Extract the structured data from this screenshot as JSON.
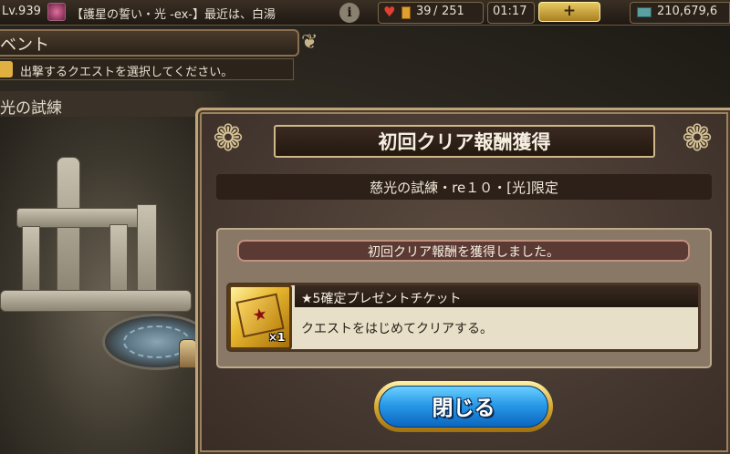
{
  "status_bar": {
    "level": "Lv.939",
    "news_ticker": "【護星の誓い・光 -ex-】最近は、白湯",
    "stamina_current": "39",
    "stamina_separator": "/",
    "stamina_max": "251",
    "timer": "01:17",
    "plus_label": "+",
    "gold": "210,679,6"
  },
  "event_panel": {
    "title": "ベント",
    "instruction": "出撃するクエストを選択してください。",
    "quest_name": "光の試練"
  },
  "modal": {
    "title": "初回クリア報酬獲得",
    "stage_name": "慈光の試練・re１０・[光]限定",
    "reward_header": "初回クリア報酬を獲得しました。",
    "reward_item": {
      "name": "★5確定プレゼントチケット",
      "description": "クエストをはじめてクリアする。",
      "quantity": "×1",
      "icon": "gold-ticket-icon"
    },
    "close_button": "閉じる"
  },
  "colors": {
    "close_button_blue": "#2a9ae8",
    "frame_gold": "#bfa479",
    "modal_brown": "#453830"
  }
}
